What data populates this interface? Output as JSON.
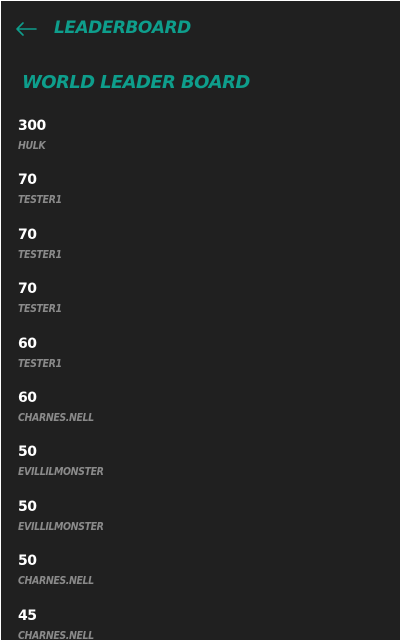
{
  "app_bar": {
    "title": "LEADERBOARD",
    "back_icon": "arrow-left-icon"
  },
  "board": {
    "title": "WORLD LEADER BOARD",
    "entries": [
      {
        "score": "300",
        "player": "HULK"
      },
      {
        "score": "70",
        "player": "TESTER1"
      },
      {
        "score": "70",
        "player": "TESTER1"
      },
      {
        "score": "70",
        "player": "TESTER1"
      },
      {
        "score": "60",
        "player": "TESTER1"
      },
      {
        "score": "60",
        "player": "CHARNES.NELL"
      },
      {
        "score": "50",
        "player": "EVILLILMONSTER"
      },
      {
        "score": "50",
        "player": "EVILLILMONSTER"
      },
      {
        "score": "50",
        "player": "CHARNES.NELL"
      },
      {
        "score": "45",
        "player": "CHARNES.NELL"
      }
    ]
  },
  "colors": {
    "background": "#202020",
    "accent": "#0e9e8c",
    "score_text": "#ffffff",
    "player_text": "#8a8a8a"
  }
}
